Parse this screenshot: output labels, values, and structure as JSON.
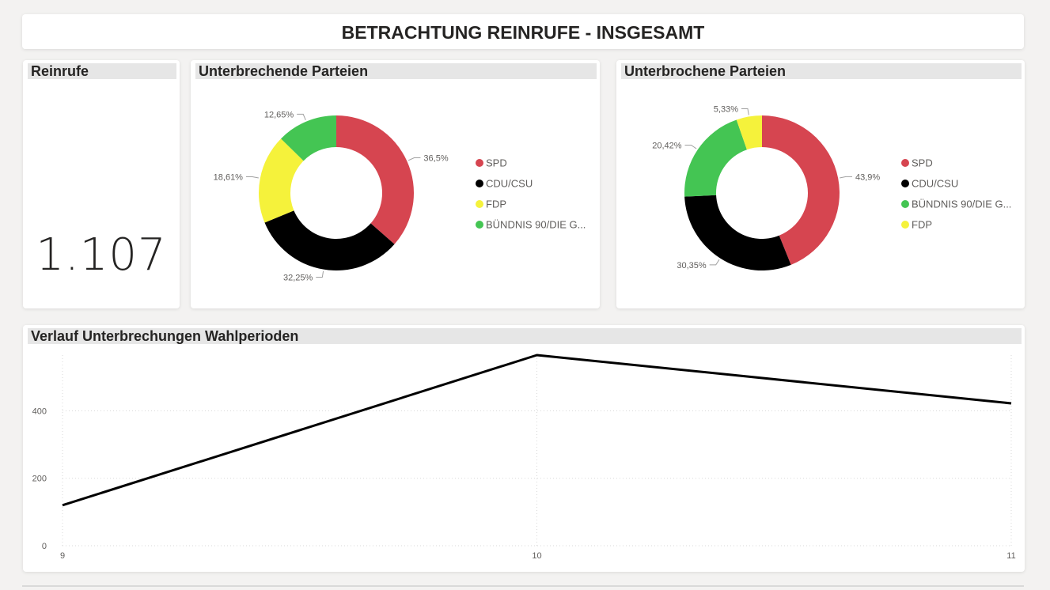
{
  "page": {
    "title": "BETRACHTUNG REINRUFE - INSGESAMT"
  },
  "kpi": {
    "title": "Reinrufe",
    "value": "1.107"
  },
  "colors": {
    "SPD": "#d64550",
    "CDU/CSU": "#000000",
    "FDP": "#f5f23b",
    "BÜNDNIS 90/DIE G...": "#44c553"
  },
  "chart_data": [
    {
      "type": "pie",
      "variant": "donut",
      "title": "Unterbrechende Parteien",
      "legend_position": "right",
      "slices": [
        {
          "name": "SPD",
          "value": 36.5,
          "label": "36,5%",
          "color": "#d64550"
        },
        {
          "name": "CDU/CSU",
          "value": 32.25,
          "label": "32,25%",
          "color": "#000000"
        },
        {
          "name": "FDP",
          "value": 18.61,
          "label": "18,61%",
          "color": "#f5f23b"
        },
        {
          "name": "BÜNDNIS 90/DIE G...",
          "value": 12.65,
          "label": "12,65%",
          "color": "#44c553"
        }
      ]
    },
    {
      "type": "pie",
      "variant": "donut",
      "title": "Unterbrochene Parteien",
      "legend_position": "right",
      "slices": [
        {
          "name": "SPD",
          "value": 43.9,
          "label": "43,9%",
          "color": "#d64550"
        },
        {
          "name": "CDU/CSU",
          "value": 30.35,
          "label": "30,35%",
          "color": "#000000"
        },
        {
          "name": "BÜNDNIS 90/DIE G...",
          "value": 20.42,
          "label": "20,42%",
          "color": "#44c553"
        },
        {
          "name": "FDP",
          "value": 5.33,
          "label": "5,33%",
          "color": "#f5f23b"
        }
      ]
    },
    {
      "type": "line",
      "title": "Verlauf Unterbrechungen Wahlperioden",
      "x": [
        9,
        10,
        11
      ],
      "series": [
        {
          "values": [
            120,
            565,
            422
          ],
          "color": "#000000"
        }
      ],
      "ylim": [
        0,
        565
      ],
      "yticks": [
        0,
        200,
        400
      ],
      "xticks": [
        "9",
        "10",
        "11"
      ],
      "grid": true
    }
  ]
}
